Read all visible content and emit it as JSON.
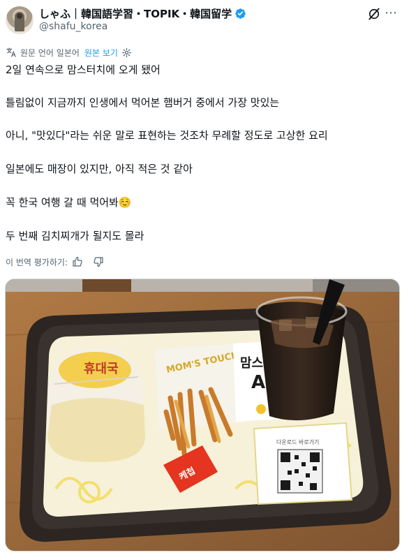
{
  "author": {
    "display_name": "しゃふ｜韓国語学習・TOPIK・韓国留学",
    "handle": "@shafu_korea",
    "verified": true
  },
  "translation_bar": {
    "source_label": "원문 언어 일본어",
    "show_original": "원본 보기"
  },
  "tweet_lines": [
    "2일 연속으로 맘스터치에 오게 됐어",
    "틀림없이 지금까지 인생에서 먹어본 햄버거 중에서 가장 맛있는",
    "아니, \"맛있다\"라는 쉬운 말로 표현하는 것조차 무례할 정도로 고상한 요리",
    "일본에도 매장이 있지만, 아직 적은 것 같아",
    "꼭 한국 여행 갈 때 먹어봐☺️",
    "두 번째 김치찌개가 될지도 몰라"
  ],
  "rate_translation": "이 번역 평가하기:",
  "photo": {
    "packet_text": "케첩",
    "box_text": "MOM'S TOUCH",
    "sign_text": "맘스",
    "sign_letter": "A",
    "qr_label": "다운로드 바로가기",
    "wrap_text": "휴대국"
  },
  "colors": {
    "accent": "#1d9bf0",
    "secondary_text": "#536471"
  },
  "icons": [
    "avatar",
    "verified-badge-icon",
    "grok-icon",
    "more-icon",
    "gear-icon",
    "translate-icon",
    "thumbs-up-icon",
    "thumbs-down-icon"
  ]
}
